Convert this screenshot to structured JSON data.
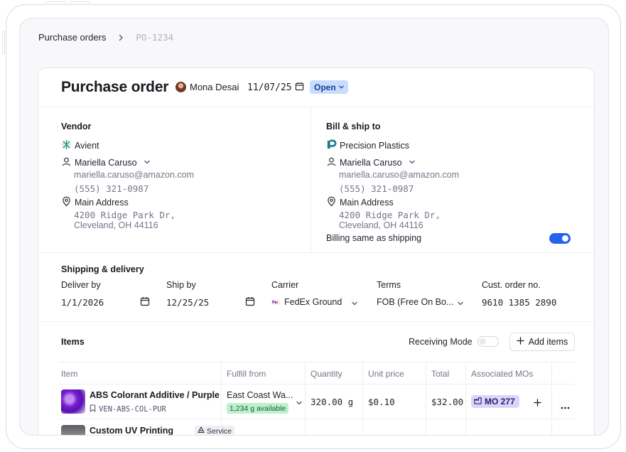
{
  "breadcrumb": {
    "parent": "Purchase orders",
    "current": "PO-1234"
  },
  "header": {
    "title": "Purchase order",
    "owner": "Mona Desai",
    "date": "11/07/25",
    "status": "Open"
  },
  "vendor": {
    "section_title": "Vendor",
    "company": "Avient",
    "contact_name": "Mariella Caruso",
    "email": "mariella.caruso@amazon.com",
    "phone": "(555) 321-0987",
    "address_label": "Main Address",
    "address_line1": "4200 Ridge Park Dr,",
    "address_line2": "Cleveland, OH 44116"
  },
  "bill_ship": {
    "section_title": "Bill & ship to",
    "company": "Precision Plastics",
    "contact_name": "Mariella Caruso",
    "email": "mariella.caruso@amazon.com",
    "phone": "(555) 321-0987",
    "address_label": "Main Address",
    "address_line1": "4200 Ridge Park Dr,",
    "address_line2": "Cleveland, OH 44116",
    "billing_same_label": "Billing same as shipping",
    "billing_same": true
  },
  "shipping": {
    "section_title": "Shipping & delivery",
    "deliver_by_label": "Deliver by",
    "deliver_by": "1/1/2026",
    "ship_by_label": "Ship by",
    "ship_by": "12/25/25",
    "carrier_label": "Carrier",
    "carrier": "FedEx Ground",
    "terms_label": "Terms",
    "terms": "FOB (Free On Bo...",
    "cust_order_label": "Cust. order no.",
    "cust_order": "9610 1385 2890"
  },
  "items": {
    "section_title": "Items",
    "receiving_mode_label": "Receiving Mode",
    "receiving_mode": false,
    "add_items_label": "Add items",
    "columns": [
      "Item",
      "Fulfill from",
      "Quantity",
      "Unit price",
      "Total",
      "Associated MOs"
    ],
    "rows": [
      {
        "name": "ABS Colorant Additive / Purple",
        "sku": "VEN-ABS-COL-PUR",
        "fulfill_from": "East Coast Wa...",
        "available": "1,234 g available",
        "quantity": "320.00 g",
        "unit_price": "$0.10",
        "total": "$32.00",
        "mo": "MO 277"
      },
      {
        "name": "Custom UV Printing",
        "tag": "Service"
      }
    ]
  },
  "colors": {
    "accent": "#2563eb",
    "status_bg": "#c8dcff",
    "available_bg": "#bdf0cd",
    "mo_bg": "#dcd4fb"
  }
}
